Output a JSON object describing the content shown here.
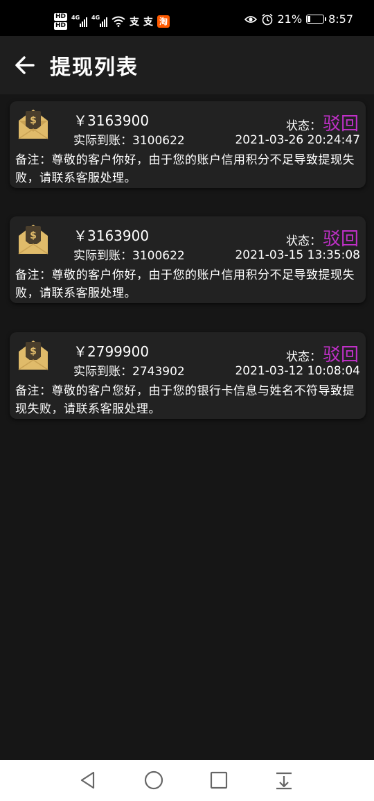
{
  "status_bar": {
    "hd1": "HD",
    "hd2": "HD",
    "net1": "4G",
    "net2": "4G",
    "app1": "支",
    "app2": "支",
    "app3": "淘",
    "battery_percent": "21%",
    "battery_level": 0.21,
    "time": "8:57"
  },
  "header": {
    "title": "提现列表"
  },
  "records": [
    {
      "amount": "￥3163900",
      "actual": "实际到账：3100622",
      "status_label": "状态：",
      "status_value": "驳回",
      "time": "2021-03-26 20:24:47",
      "remark": "备注：尊敬的客户你好，由于您的账户信用积分不足导致提现失败，请联系客服处理。"
    },
    {
      "amount": "￥3163900",
      "actual": "实际到账：3100622",
      "status_label": "状态：",
      "status_value": "驳回",
      "time": "2021-03-15 13:35:08",
      "remark": "备注：尊敬的客户你好，由于您的账户信用积分不足导致提现失败，请联系客服处理。"
    },
    {
      "amount": "￥2799900",
      "actual": "实际到账：2743902",
      "status_label": "状态：",
      "status_value": "驳回",
      "time": "2021-03-12 10:08:04",
      "remark": "备注：尊敬的客户您好，由于您的银行卡信息与姓名不符导致提现失败，请联系客服处理。"
    }
  ],
  "icons": {
    "back": "arrow-left-icon",
    "record": "money-envelope-icon",
    "nav_back": "triangle-back-icon",
    "nav_home": "circle-home-icon",
    "nav_recent": "square-recent-icon",
    "nav_notify": "download-tray-icon"
  },
  "colors": {
    "status_rejected": "#c030c8",
    "envelope": "#e0bb6a",
    "envelope_flap": "#4a3e2c"
  }
}
